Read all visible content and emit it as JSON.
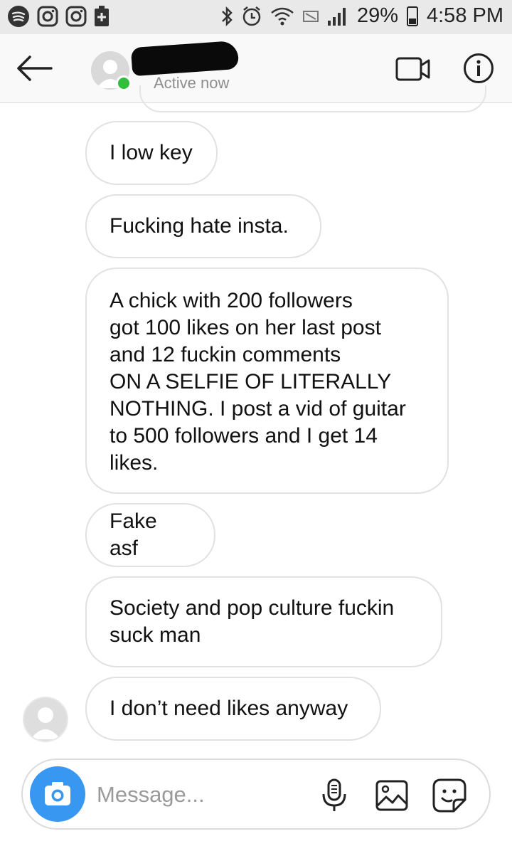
{
  "status_bar": {
    "battery": "29%",
    "time": "4:58 PM"
  },
  "header": {
    "status": "Active now"
  },
  "messages": [
    "I low key",
    "Fucking hate insta.",
    "A chick with 200 followers\ngot 100 likes on her last post\nand 12 fuckin comments\nON A SELFIE OF LITERALLY\nNOTHING. I post a vid of guitar\nto 500 followers and I get 14\nlikes.",
    "Fake asf",
    "Society and pop culture fuckin\nsuck man",
    "I don’t need likes anyway"
  ],
  "composer": {
    "placeholder": "Message..."
  },
  "icons": [
    "back-arrow-icon",
    "video-call-icon",
    "info-icon",
    "camera-icon",
    "microphone-icon",
    "gallery-icon",
    "sticker-icon"
  ],
  "colors": {
    "accent": "#3897f0",
    "active": "#2fbf3a"
  }
}
